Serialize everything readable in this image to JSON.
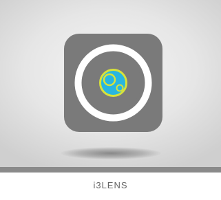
{
  "app": {
    "name": "i3LENS",
    "icon": "camera-lens-icon"
  },
  "colors": {
    "icon_background": "#7a7a7a",
    "ring": "#ffffff",
    "lens_fill": "#29b6e0",
    "lens_outline": "#d8e23a",
    "bottom_bar": "#8a8a8a",
    "label_text": "#666666"
  }
}
